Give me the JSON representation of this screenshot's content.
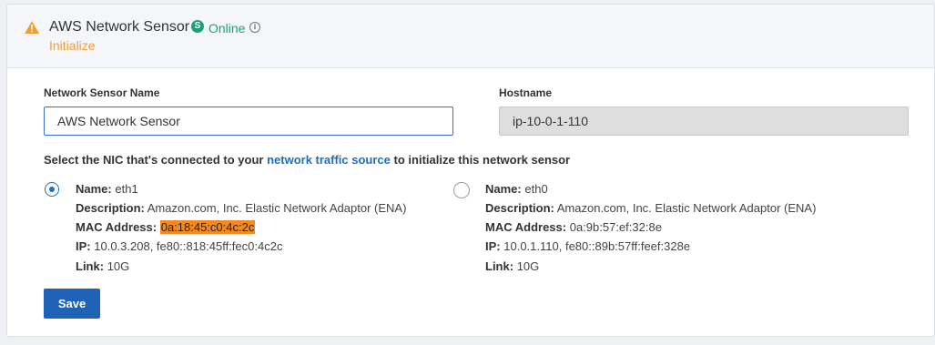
{
  "header": {
    "title": "AWS Network Sensor",
    "status_icon_glyph": "S",
    "status": "Online",
    "info_icon_glyph": "i",
    "subtitle": "Initialize",
    "warning_color": "#f0a030",
    "status_color": "#1aa179"
  },
  "form": {
    "name_label": "Network Sensor Name",
    "name_value": "AWS Network Sensor",
    "hostname_label": "Hostname",
    "hostname_value": "ip-10-0-1-110"
  },
  "prompt": {
    "before": "Select the NIC that's connected to your ",
    "link": "network traffic source",
    "after": " to initialize this network sensor"
  },
  "field_labels": {
    "name": "Name:",
    "description": "Description:",
    "mac": "MAC Address:",
    "ip": "IP:",
    "link": "Link:"
  },
  "nics": [
    {
      "selected": true,
      "name": "eth1",
      "description": "Amazon.com, Inc. Elastic Network Adaptor (ENA)",
      "mac": "0a:18:45:c0:4c:2c",
      "ip": "10.0.3.208, fe80::818:45ff:fec0:4c2c",
      "link": "10G"
    },
    {
      "selected": false,
      "name": "eth0",
      "description": "Amazon.com, Inc. Elastic Network Adaptor (ENA)",
      "mac": "0a:9b:57:ef:32:8e",
      "ip": "10.0.1.110, fe80::89b:57ff:feef:328e",
      "link": "10G"
    }
  ],
  "actions": {
    "save_label": "Save"
  },
  "icons": {
    "warning": "warning-triangle-icon",
    "status": "online-status-icon",
    "info": "info-circle-icon",
    "radio_selected": "radio-selected",
    "radio_unselected": "radio-unselected"
  },
  "colors": {
    "primary": "#1f63b6",
    "link": "#1f6fb8",
    "highlight": "#f28a22"
  }
}
